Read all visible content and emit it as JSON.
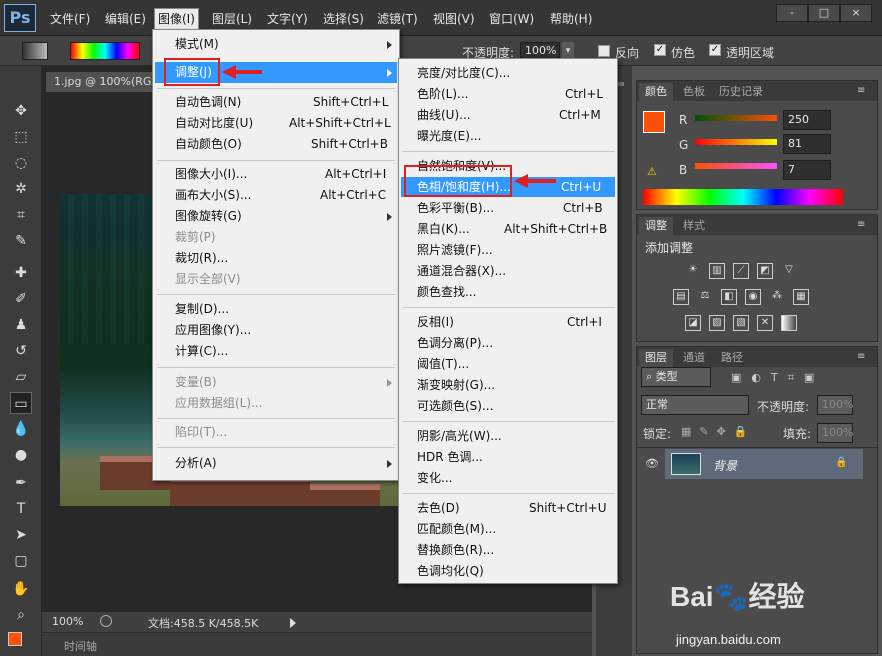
{
  "app": {
    "logo": "Ps"
  },
  "menubar": {
    "items": [
      "文件(F)",
      "编辑(E)",
      "图像(I)",
      "图层(L)",
      "文字(Y)",
      "选择(S)",
      "滤镜(T)",
      "视图(V)",
      "窗口(W)",
      "帮助(H)"
    ],
    "window_buttons": [
      "-",
      "□",
      "×"
    ]
  },
  "options": {
    "opacity_label": "不透明度:",
    "opacity_value": "100%",
    "reverse": "反向",
    "dither": "仿色",
    "transparency": "透明区域"
  },
  "document": {
    "tab": "1.jpg @ 100%(RGB",
    "zoom": "100%",
    "doc_info": "文档:458.5 K/458.5K",
    "timeline": "时间轴"
  },
  "image_menu": {
    "items": [
      {
        "label": "模式(M)",
        "shortcut": "",
        "submenu": true,
        "disabled": false
      },
      {
        "label": "调整(J)",
        "shortcut": "",
        "submenu": true,
        "disabled": false
      },
      {
        "label": "自动色调(N)",
        "shortcut": "Shift+Ctrl+L"
      },
      {
        "label": "自动对比度(U)",
        "shortcut": "Alt+Shift+Ctrl+L"
      },
      {
        "label": "自动颜色(O)",
        "shortcut": "Shift+Ctrl+B"
      },
      {
        "label": "图像大小(I)...",
        "shortcut": "Alt+Ctrl+I"
      },
      {
        "label": "画布大小(S)...",
        "shortcut": "Alt+Ctrl+C"
      },
      {
        "label": "图像旋转(G)",
        "shortcut": "",
        "submenu": true
      },
      {
        "label": "裁剪(P)",
        "shortcut": "",
        "disabled": true
      },
      {
        "label": "裁切(R)...",
        "shortcut": ""
      },
      {
        "label": "显示全部(V)",
        "shortcut": "",
        "disabled": true
      },
      {
        "label": "复制(D)...",
        "shortcut": ""
      },
      {
        "label": "应用图像(Y)...",
        "shortcut": ""
      },
      {
        "label": "计算(C)...",
        "shortcut": ""
      },
      {
        "label": "变量(B)",
        "shortcut": "",
        "submenu": true,
        "disabled": true
      },
      {
        "label": "应用数据组(L)...",
        "shortcut": "",
        "disabled": true
      },
      {
        "label": "陷印(T)...",
        "shortcut": "",
        "disabled": true
      },
      {
        "label": "分析(A)",
        "shortcut": "",
        "submenu": true
      }
    ]
  },
  "adjust_menu": {
    "items": [
      {
        "label": "亮度/对比度(C)...",
        "shortcut": ""
      },
      {
        "label": "色阶(L)...",
        "shortcut": "Ctrl+L"
      },
      {
        "label": "曲线(U)...",
        "shortcut": "Ctrl+M"
      },
      {
        "label": "曝光度(E)...",
        "shortcut": ""
      },
      {
        "label": "自然饱和度(V)...",
        "shortcut": ""
      },
      {
        "label": "色相/饱和度(H)...",
        "shortcut": "Ctrl+U"
      },
      {
        "label": "色彩平衡(B)...",
        "shortcut": "Ctrl+B"
      },
      {
        "label": "黑白(K)...",
        "shortcut": "Alt+Shift+Ctrl+B"
      },
      {
        "label": "照片滤镜(F)...",
        "shortcut": ""
      },
      {
        "label": "通道混合器(X)...",
        "shortcut": ""
      },
      {
        "label": "颜色查找...",
        "shortcut": ""
      },
      {
        "label": "反相(I)",
        "shortcut": "Ctrl+I"
      },
      {
        "label": "色调分离(P)...",
        "shortcut": ""
      },
      {
        "label": "阈值(T)...",
        "shortcut": ""
      },
      {
        "label": "渐变映射(G)...",
        "shortcut": ""
      },
      {
        "label": "可选颜色(S)...",
        "shortcut": ""
      },
      {
        "label": "阴影/高光(W)...",
        "shortcut": ""
      },
      {
        "label": "HDR 色调...",
        "shortcut": ""
      },
      {
        "label": "变化...",
        "shortcut": ""
      },
      {
        "label": "去色(D)",
        "shortcut": "Shift+Ctrl+U"
      },
      {
        "label": "匹配颜色(M)...",
        "shortcut": ""
      },
      {
        "label": "替换颜色(R)...",
        "shortcut": ""
      },
      {
        "label": "色调均化(Q)",
        "shortcut": ""
      }
    ]
  },
  "color_panel": {
    "tabs": [
      "颜色",
      "色板",
      "历史记录"
    ],
    "r_label": "R",
    "r_value": "250",
    "g_label": "G",
    "g_value": "81",
    "b_label": "B",
    "b_value": "7",
    "swatch_color": "#fa5107"
  },
  "adjust_panel": {
    "tabs": [
      "调整",
      "样式"
    ],
    "title": "添加调整"
  },
  "layers_panel": {
    "tabs": [
      "图层",
      "通道",
      "路径"
    ],
    "filter": "类型",
    "blend_mode": "正常",
    "opacity_label": "不透明度:",
    "opacity_value": "100%",
    "lock_label": "锁定:",
    "fill_label": "填充:",
    "fill_value": "100%",
    "layer_name": "背景"
  },
  "watermark": {
    "brand": "Bai",
    "brand2": "经验",
    "url": "jingyan.baidu.com"
  }
}
